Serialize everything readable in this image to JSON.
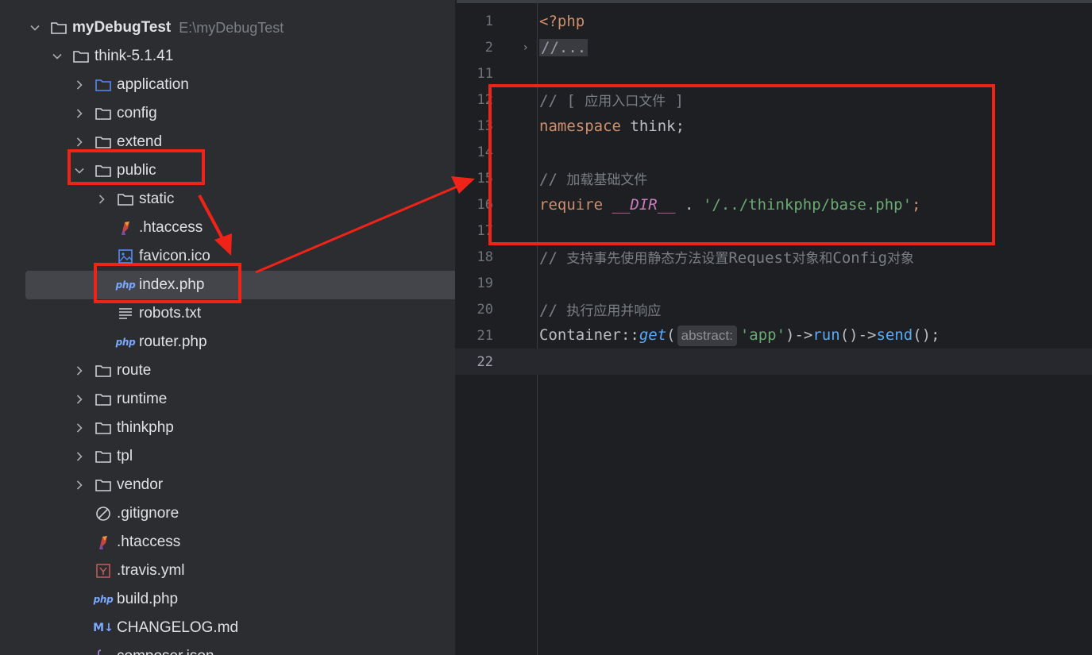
{
  "tree": {
    "root": {
      "name": "myDebugTest",
      "path": "E:\\myDebugTest"
    },
    "items": [
      {
        "label": "think-5.1.41"
      },
      {
        "label": "application"
      },
      {
        "label": "config"
      },
      {
        "label": "extend"
      },
      {
        "label": "public"
      },
      {
        "label": "static"
      },
      {
        "label": ".htaccess"
      },
      {
        "label": "favicon.ico"
      },
      {
        "label": "index.php"
      },
      {
        "label": "robots.txt"
      },
      {
        "label": "router.php"
      },
      {
        "label": "route"
      },
      {
        "label": "runtime"
      },
      {
        "label": "thinkphp"
      },
      {
        "label": "tpl"
      },
      {
        "label": "vendor"
      },
      {
        "label": ".gitignore"
      },
      {
        "label": ".htaccess"
      },
      {
        "label": ".travis.yml"
      },
      {
        "label": "build.php"
      },
      {
        "label": "CHANGELOG.md"
      },
      {
        "label": "composer.json"
      }
    ],
    "php_badge": "php",
    "md_badge": "M↓"
  },
  "editor": {
    "line_numbers": [
      "1",
      "2",
      "11",
      "12",
      "13",
      "14",
      "15",
      "16",
      "17",
      "18",
      "19",
      "20",
      "21",
      "22"
    ],
    "l1": "<?php",
    "l2": "//...",
    "l12_a": "// [ ",
    "l12_b": "应用入口文件",
    "l12_c": " ]",
    "l13_kw": "namespace",
    "l13_rest": " think;",
    "l15_a": "// ",
    "l15_b": "加载基础文件",
    "l16_kw": "require",
    "l16_const": "__DIR__",
    "l16_op": " . ",
    "l16_str": "'/../thinkphp/base.php'",
    "l16_end": ";",
    "l18_a": "// ",
    "l18_b": "支持事先使用静态方法设置",
    "l18_c": "Request",
    "l18_d": "对象和",
    "l18_e": "Config",
    "l18_f": "对象",
    "l20_a": "// ",
    "l20_b": "执行应用并响应",
    "l21_cls": "Container::",
    "l21_fn": "get",
    "l21_p1": "(",
    "l21_hint": "abstract:",
    "l21_str": "'app'",
    "l21_arrow1": ")->",
    "l21_run": "run",
    "l21_arrow2": "()->",
    "l21_send": "send",
    "l21_end": "();"
  },
  "colors": {
    "annotation": "#f02318",
    "folder_blue": "#548af7",
    "php_badge": "#7ca8ff"
  }
}
